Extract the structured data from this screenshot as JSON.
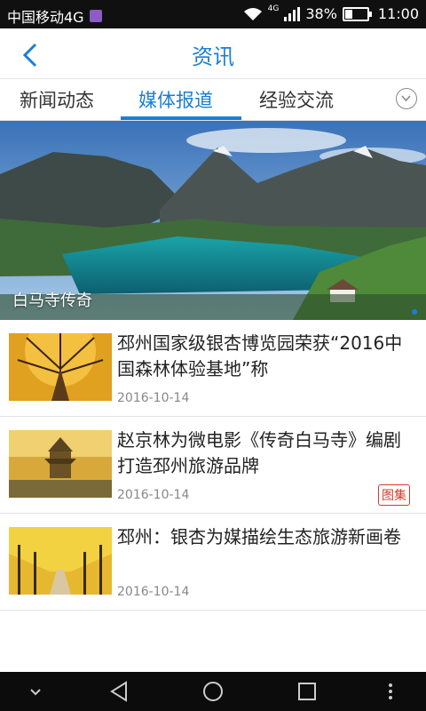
{
  "status": {
    "carrier": "中国移动4G",
    "battery": "38%",
    "time": "11:00",
    "battery_level": 0.38,
    "network": "4G"
  },
  "header": {
    "title": "资讯"
  },
  "tabs": [
    {
      "label": "新闻动态",
      "active": false
    },
    {
      "label": "媒体报道",
      "active": true
    },
    {
      "label": "经验交流",
      "active": false
    }
  ],
  "banner": {
    "caption": "白马寺传奇"
  },
  "articles": [
    {
      "title": "邳州国家级银杏博览园荣获“2016中国森林体验基地”称",
      "date": "2016-10-14",
      "tag": ""
    },
    {
      "title": "赵京林为微电影《传奇白马寺》编剧 打造邳州旅游品牌",
      "date": "2016-10-14",
      "tag": "图集"
    },
    {
      "title": "邳州：银杏为媒描绘生态旅游新画卷",
      "date": "2016-10-14",
      "tag": ""
    }
  ],
  "colors": {
    "accent": "#1a7fd6",
    "tag": "#d23a2a"
  }
}
